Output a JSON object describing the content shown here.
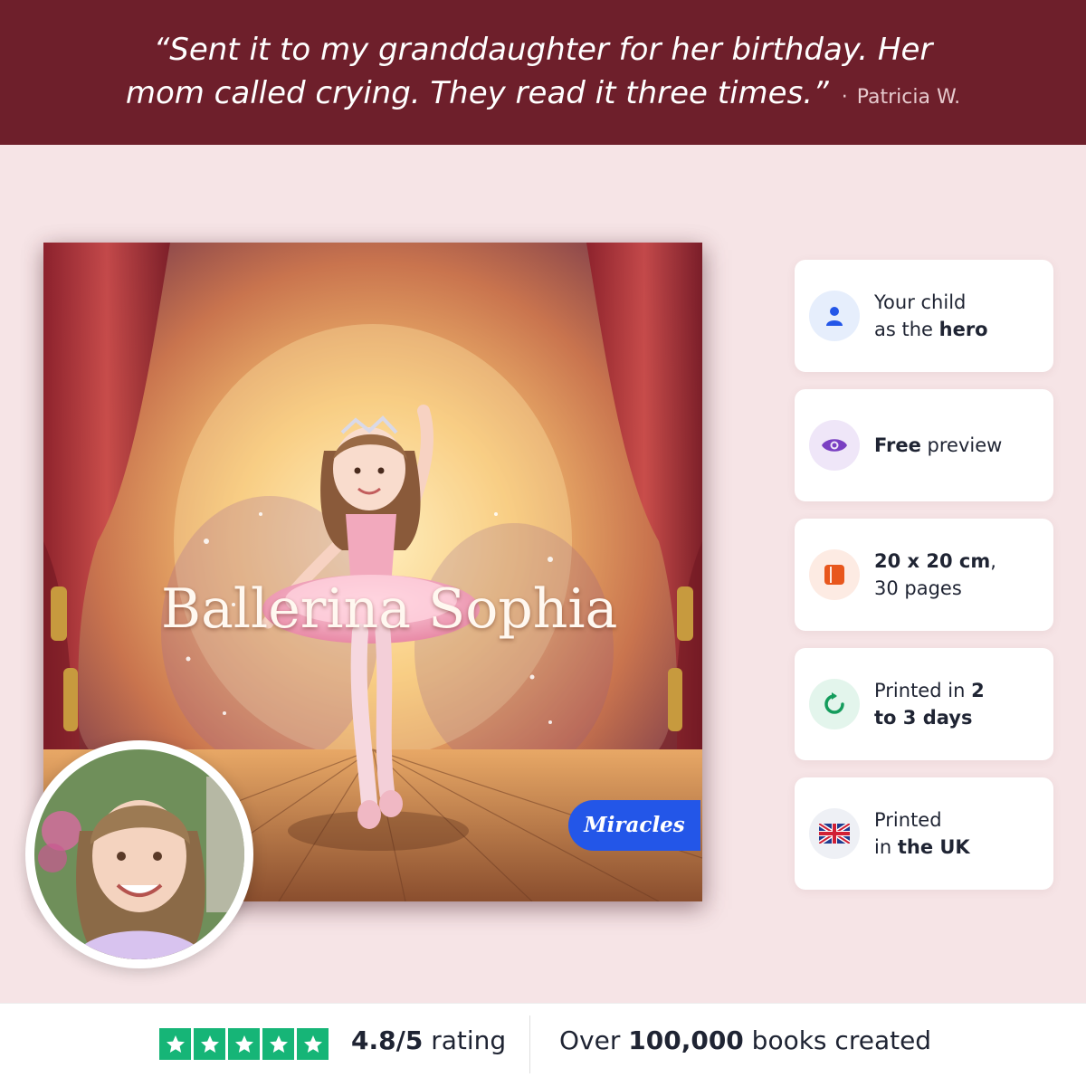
{
  "testimonial": {
    "line1": "“Sent it to my granddaughter for her birthday. Her",
    "line2": "mom called crying. They read it three times.”",
    "separator": "·",
    "author": "Patricia W."
  },
  "book": {
    "title": "Ballerina Sophia",
    "brand": "Miracles"
  },
  "features": [
    {
      "icon": "person-icon",
      "pre": "Your child",
      "mid": "as the ",
      "bold": "hero",
      "post": ""
    },
    {
      "icon": "eye-icon",
      "bold": "Free",
      "post": " preview"
    },
    {
      "icon": "book-icon",
      "bold": "20 x 20 cm",
      "post": ",",
      "line2": "30 pages"
    },
    {
      "icon": "refresh-icon",
      "pre": "Printed in ",
      "bold": "2",
      "bold2": "to 3 days"
    },
    {
      "icon": "uk-flag-icon",
      "pre": "Printed",
      "mid": "in ",
      "bold": "the UK"
    }
  ],
  "footer": {
    "rating_value": "4.8/5",
    "rating_label": " rating",
    "stars": 5,
    "created_pre": "Over ",
    "created_bold": "100,000",
    "created_post": " books created"
  },
  "colors": {
    "banner": "#6e1f2b",
    "background": "#f6e4e6",
    "brand_blue": "#2356e8",
    "star_green": "#16b577"
  }
}
